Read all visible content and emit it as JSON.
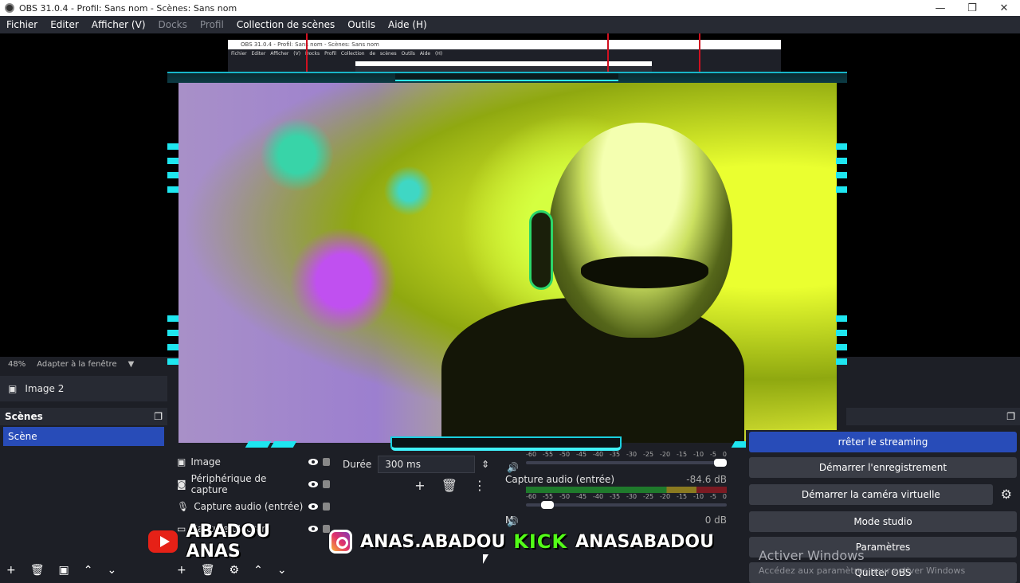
{
  "titlebar": {
    "title": "OBS 31.0.4 - Profil: Sans nom - Scènes: Sans nom",
    "min": "—",
    "max": "❐",
    "close": "✕"
  },
  "menu": [
    "Fichier",
    "Editer",
    "Afficher (V)",
    "Docks",
    "Profil",
    "Collection de scènes",
    "Outils",
    "Aide (H)"
  ],
  "nested_window": {
    "title": "OBS 31.0.4 - Profil: Sans nom - Scènes: Sans nom",
    "menu": "Fichier Editer Afficher (V) Docks Profil Collection de scènes Outils Aide (H)"
  },
  "preview_status": {
    "zoom": "48%",
    "fit": "Adapter à la fenêtre"
  },
  "selected_source": "Image 2",
  "scenes": {
    "title": "Scènes",
    "items": [
      "Scène"
    ]
  },
  "sources": [
    {
      "icon": "image-icon",
      "label": "Image"
    },
    {
      "icon": "camera-icon",
      "label": "Périphérique de capture"
    },
    {
      "icon": "microphone-icon",
      "label": "Capture audio (entrée)"
    },
    {
      "icon": "monitor-icon",
      "label": "Capture d'écran"
    }
  ],
  "transitions": {
    "duration_label": "Durée",
    "duration_value": "300 ms"
  },
  "mixer": {
    "ticks": [
      "-60",
      "-55",
      "-50",
      "-45",
      "-40",
      "-35",
      "-30",
      "-25",
      "-20",
      "-15",
      "-10",
      "-5",
      "0"
    ],
    "channel2_name": "Capture audio (entrée)",
    "channel2_db": "-84.6 dB",
    "channel3_prefix": "M",
    "channel3_db": "0 dB",
    "channel1_volume": 1.0,
    "channel2_volume": 0.08
  },
  "controls": {
    "stop_streaming": "rrêter le streaming",
    "start_recording": "Démarrer l'enregistrement",
    "start_virtual_cam": "Démarrer la caméra virtuelle",
    "studio_mode": "Mode studio",
    "settings": "Paramètres",
    "quit": "Quitter OBS"
  },
  "watermark": {
    "line1": "Activer Windows",
    "line2": "Accédez aux paramètres pour activer Windows"
  },
  "overlay": {
    "youtube": "ABADOU ANAS",
    "instagram": "ANAS.ABADOU",
    "kick_logo": "KICK",
    "kick": "ANASABADOU"
  },
  "colors": {
    "accent": "#284cb8",
    "frame": "#1ee6f0",
    "kick": "#53fc18"
  }
}
